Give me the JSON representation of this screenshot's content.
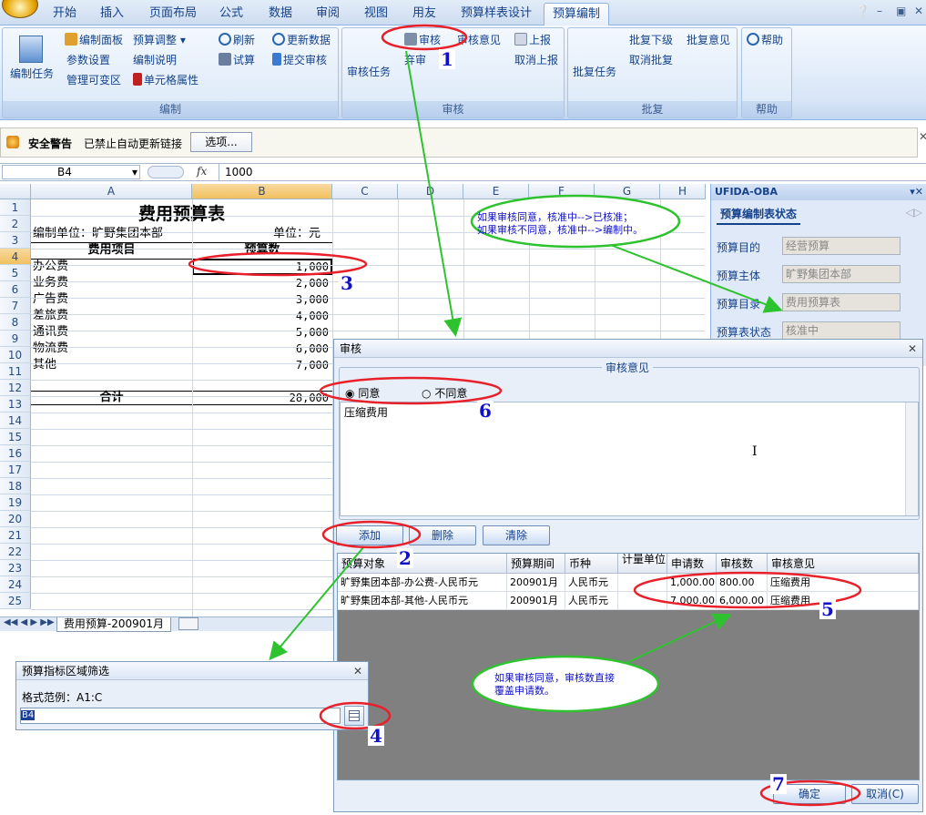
{
  "tabs": [
    "开始",
    "插入",
    "页面布局",
    "公式",
    "数据",
    "审阅",
    "视图",
    "用友",
    "预算样表设计",
    "预算编制"
  ],
  "ribbon": {
    "edit_task": "编制任务",
    "edit_panel": "编制面板",
    "budget_adjust": "预算调整",
    "param_setup": "参数设置",
    "edit_notes": "编制说明",
    "manage_var_area": "管理可变区",
    "cell_props": "单元格属性",
    "refresh": "刷新",
    "update_data": "更新数据",
    "trial_calc": "试算",
    "submit_review": "提交审核",
    "group_edit": "编制",
    "review_task": "审核任务",
    "review": "审核",
    "review_opinion": "审核意见",
    "abandon_review": "弃审",
    "report_up": "上报",
    "cancel_report": "取消上报",
    "group_review": "审核",
    "reply_task": "批复任务",
    "reply_lower": "批复下级",
    "reply_opinion": "批复意见",
    "cancel_reply": "取消批复",
    "group_reply": "批复",
    "help": "帮助",
    "group_help": "帮助"
  },
  "security": {
    "title": "安全警告",
    "message": "已禁止自动更新链接",
    "options": "选项..."
  },
  "formula_bar": {
    "name_box": "B4",
    "fx": "fx",
    "value": "1000"
  },
  "sheet": {
    "columns": [
      "A",
      "B",
      "C",
      "D",
      "E",
      "F",
      "G",
      "H"
    ],
    "rows": [
      "1",
      "2",
      "3",
      "4",
      "5",
      "6",
      "7",
      "8",
      "9",
      "10",
      "11",
      "12",
      "13",
      "14",
      "15",
      "16",
      "17",
      "18",
      "19",
      "20",
      "21",
      "22",
      "23",
      "24",
      "25"
    ],
    "title": "费用预算表",
    "unit_org": "编制单位：旷野集团本部",
    "unit": "单位：元",
    "hdr_item": "费用项目",
    "hdr_amount": "预算数",
    "items": [
      {
        "name": "办公费",
        "amount": "1,000"
      },
      {
        "name": "业务费",
        "amount": "2,000"
      },
      {
        "name": "广告费",
        "amount": "3,000"
      },
      {
        "name": "差旅费",
        "amount": "4,000"
      },
      {
        "name": "通讯费",
        "amount": "5,000"
      },
      {
        "name": "物流费",
        "amount": "6,000"
      },
      {
        "name": "其他",
        "amount": "7,000"
      }
    ],
    "total_label": "合计",
    "total": "28,000",
    "sheet_tab": "费用预算-200901月"
  },
  "oba": {
    "title": "UFIDA-OBA",
    "tab": "预算编制表状态",
    "fields": [
      {
        "label": "预算目的",
        "value": "经营预算"
      },
      {
        "label": "预算主体",
        "value": "旷野集团本部"
      },
      {
        "label": "预算目录",
        "value": "费用预算表"
      },
      {
        "label": "预算表状态",
        "value": "核准中"
      }
    ]
  },
  "dialog": {
    "title": "审核",
    "section": "审核意见",
    "agree": "同意",
    "disagree": "不同意",
    "opinion_text": "压缩费用",
    "add": "添加",
    "delete": "删除",
    "clear": "清除",
    "headers": [
      "预算对象",
      "预算期间",
      "币种",
      "计量单位",
      "申请数",
      "审核数",
      "审核意见"
    ],
    "rows": [
      [
        "旷野集团本部-办公费-人民币元",
        "200901月",
        "人民币元",
        "",
        "1,000.00",
        "800.00",
        "压缩费用"
      ],
      [
        "旷野集团本部-其他-人民币元",
        "200901月",
        "人民币元",
        "",
        "7,000.00",
        "6,000.00",
        "压缩费用"
      ]
    ],
    "ok": "确定",
    "cancel": "取消(C)"
  },
  "filter_dialog": {
    "title": "预算指标区域筛选",
    "format_hint": "格式范例：A1:C",
    "value": "B4"
  },
  "annotations": {
    "n1": "1",
    "n2": "2",
    "n3": "3",
    "n4": "4",
    "n5": "5",
    "n6": "6",
    "n7": "7",
    "note_status_1": "如果审核同意，核准中-->已核准；",
    "note_status_2": "如果审核不同意，核准中-->编制中。",
    "note_override_1": "如果审核同意，审核数直接",
    "note_override_2": "覆盖申请数。"
  },
  "colors": {
    "annotation_red": "#e8202a",
    "annotation_green": "#2ec22e",
    "annotation_number": "#1010c8"
  }
}
